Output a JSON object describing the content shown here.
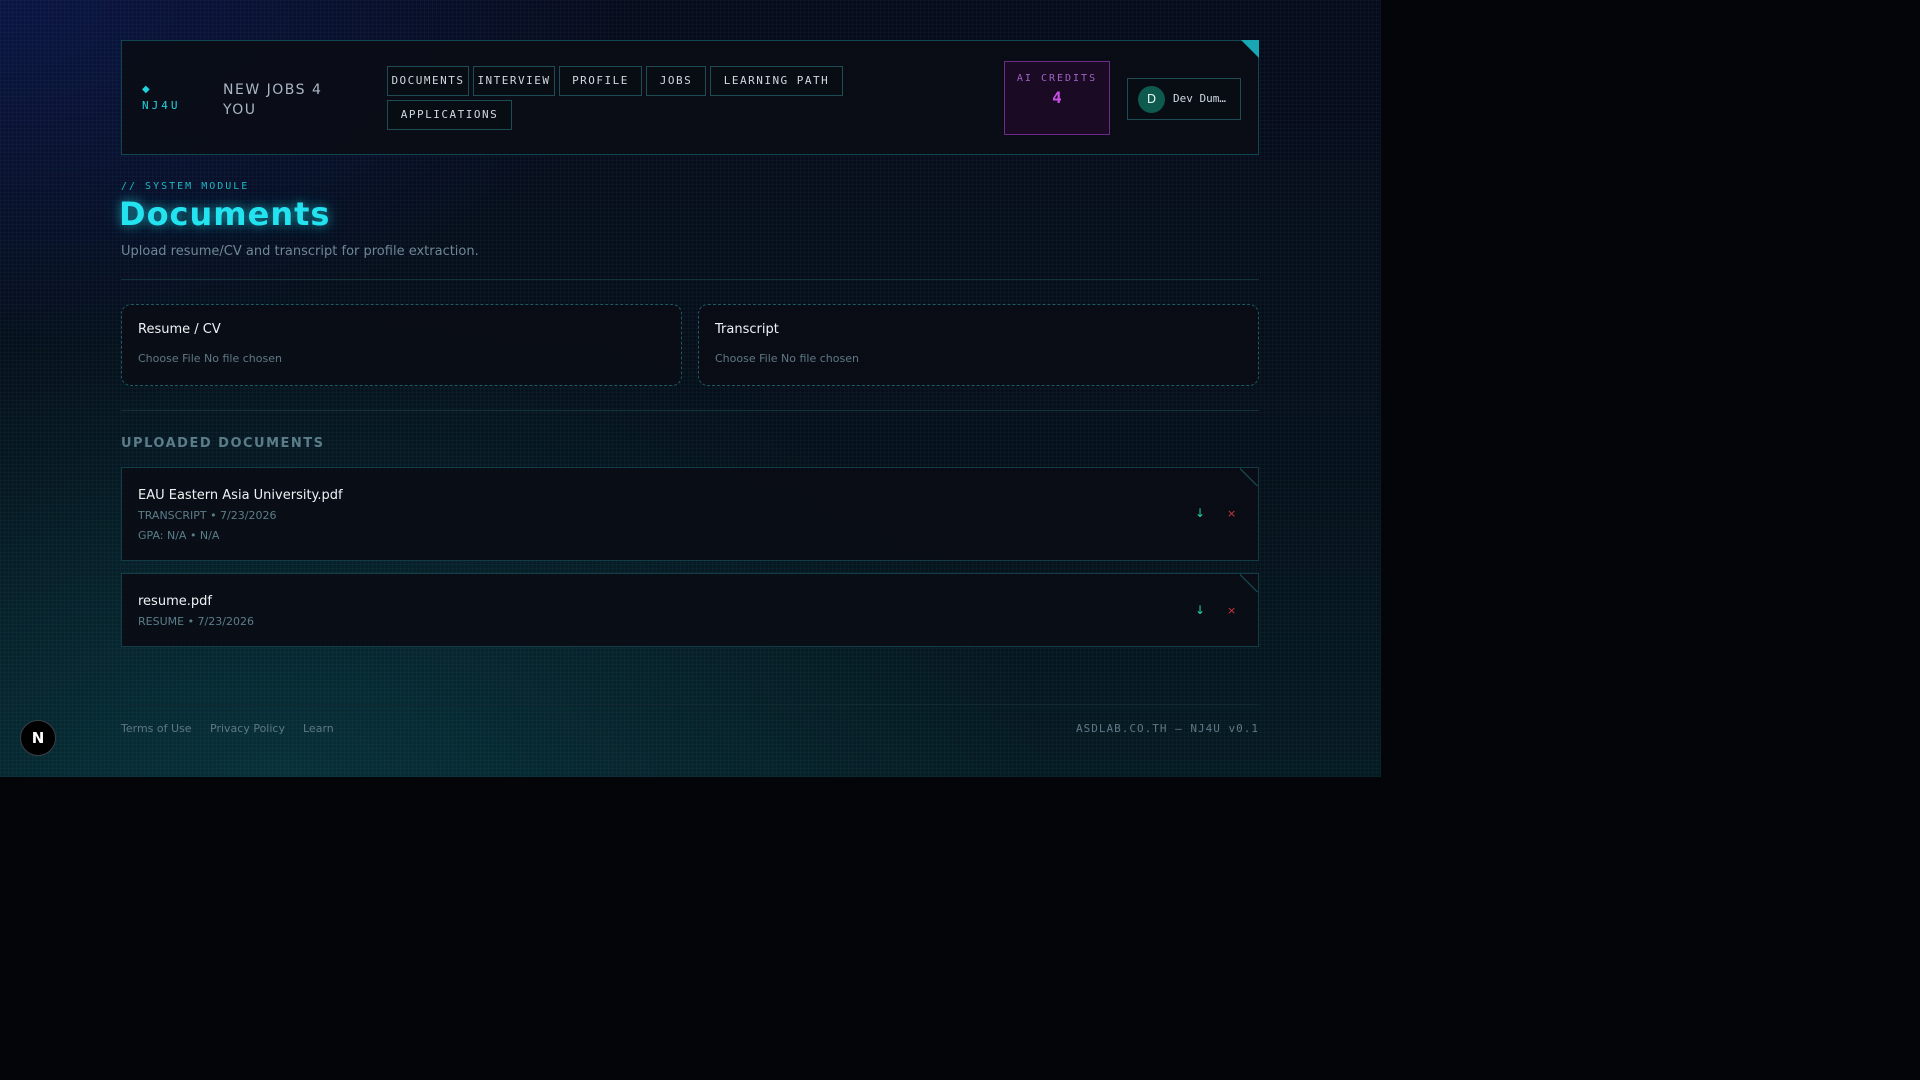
{
  "header": {
    "logo_glyph": "◆",
    "logo_text": "NJ4U",
    "brand": "NEW JOBS 4 YOU",
    "nav": [
      {
        "label": "DOCUMENTS"
      },
      {
        "label": "INTERVIEW"
      },
      {
        "label": "PROFILE"
      },
      {
        "label": "JOBS"
      },
      {
        "label": "LEARNING PATH"
      },
      {
        "label": "APPLICATIONS"
      }
    ],
    "credits": {
      "label": "AI CREDITS",
      "value": "4"
    },
    "user": {
      "initial": "D",
      "name": "Dev Dum…"
    }
  },
  "page": {
    "module": "// SYSTEM MODULE",
    "title": "Documents",
    "subtitle": "Upload resume/CV and transcript for profile extraction."
  },
  "uploads": [
    {
      "title": "Resume / CV",
      "file_text": "Choose File No file chosen"
    },
    {
      "title": "Transcript",
      "file_text": "Choose File No file chosen"
    }
  ],
  "uploaded": {
    "title": "UPLOADED DOCUMENTS",
    "items": [
      {
        "name": "EAU Eastern Asia University.pdf",
        "meta": "TRANSCRIPT • 7/23/2026",
        "extra": "GPA: N/A • N/A"
      },
      {
        "name": "resume.pdf",
        "meta": "RESUME • 7/23/2026",
        "extra": ""
      }
    ],
    "download_glyph": "↓",
    "delete_glyph": "×"
  },
  "footer": {
    "links": [
      "Terms of Use",
      "Privacy Policy",
      "Learn"
    ],
    "version": "ASDLAB.CO.TH — NJ4U v0.1"
  },
  "badge": {
    "letter": "N"
  },
  "colors": {
    "accent": "#23e3f0",
    "credits": "#c94fe6",
    "delete": "#d2363a",
    "download": "#1fd3b0"
  }
}
